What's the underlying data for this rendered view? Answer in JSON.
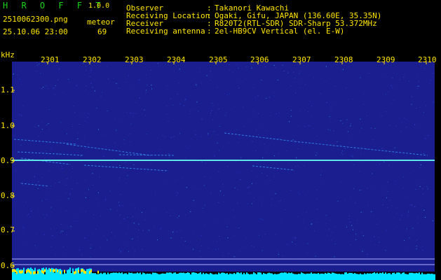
{
  "app": {
    "name": "H R O F F T",
    "version": "1.0.0",
    "filename": "2510062300.png",
    "datetime": "25.10.06 23:00",
    "meteor_label": "meteor",
    "meteor_count": "69"
  },
  "info": {
    "rows": [
      {
        "key": "Observer",
        "value": "Takanori Kawachi"
      },
      {
        "key": "Receiving Location",
        "value": "Ogaki, Gifu, JAPAN (136.60E, 35.35N)"
      },
      {
        "key": "Receiver",
        "value": "R820T2(RTL-SDR) SDR-Sharp 53.372MHz"
      },
      {
        "key": "Receiving antenna",
        "value": "2el-HB9CV Vertical (el. E-W)"
      }
    ]
  },
  "axis": {
    "unit": "kHz",
    "time_ticks": [
      "2301",
      "2302",
      "2303",
      "2304",
      "2305",
      "2306",
      "2307",
      "2308",
      "2309",
      "2310"
    ],
    "freq_ticks": [
      "1.1",
      "1.0",
      "0.9",
      "0.8",
      "0.7",
      "0.6"
    ]
  },
  "colors": {
    "background": "#1a1e8f",
    "yellow": "#ffe600",
    "green": "#19d619",
    "cyan": "#00e5ff"
  }
}
